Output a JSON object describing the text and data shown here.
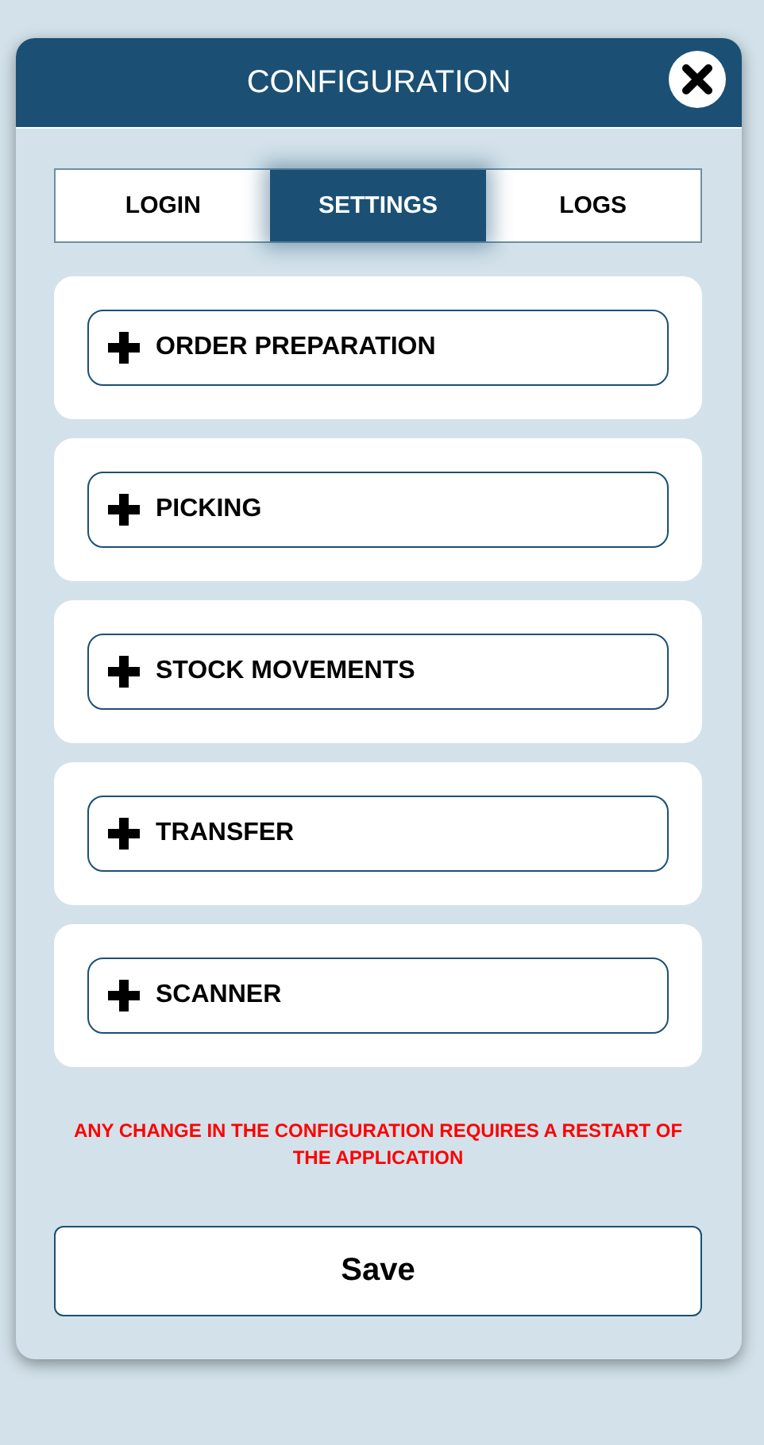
{
  "dialog": {
    "title": "CONFIGURATION"
  },
  "tabs": [
    {
      "label": "LOGIN",
      "selected": false
    },
    {
      "label": "SETTINGS",
      "selected": true
    },
    {
      "label": "LOGS",
      "selected": false
    }
  ],
  "sections": [
    {
      "label": "ORDER PREPARATION",
      "expanded": false
    },
    {
      "label": "PICKING",
      "expanded": false
    },
    {
      "label": "STOCK MOVEMENTS",
      "expanded": false
    },
    {
      "label": "TRANSFER",
      "expanded": false
    },
    {
      "label": "SCANNER",
      "expanded": false
    }
  ],
  "warning": "ANY CHANGE IN THE CONFIGURATION REQUIRES A RESTART OF THE APPLICATION",
  "save_button": "Save"
}
